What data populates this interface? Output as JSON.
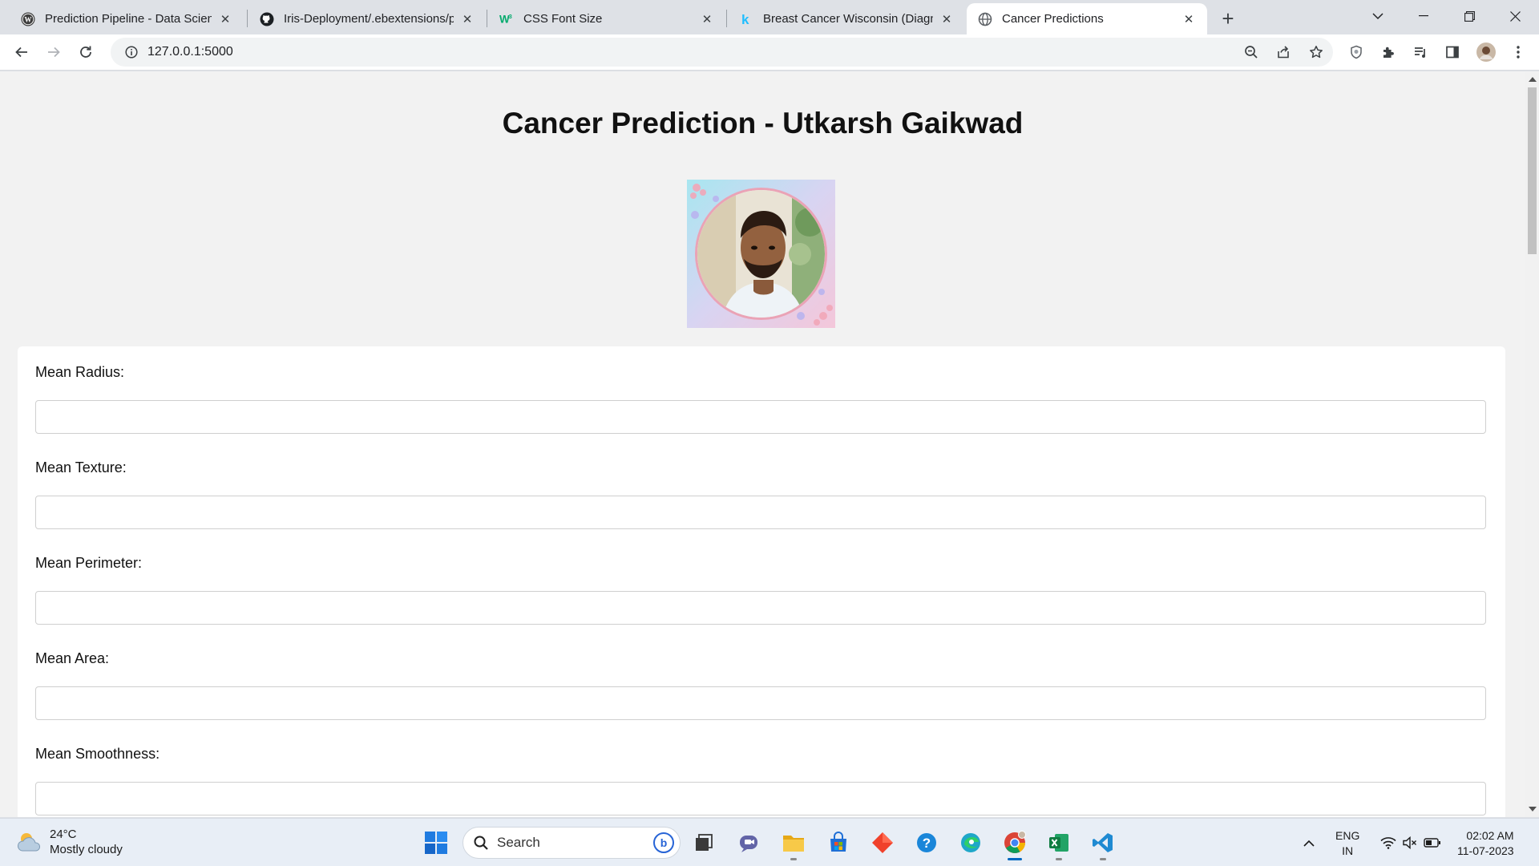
{
  "browser": {
    "tabs": [
      {
        "title": "Prediction Pipeline - Data Scienc",
        "icon": "wordpress-icon",
        "active": false
      },
      {
        "title": "Iris-Deployment/.ebextensions/p",
        "icon": "github-icon",
        "active": false
      },
      {
        "title": "CSS Font Size",
        "icon": "w3schools-icon",
        "active": false
      },
      {
        "title": "Breast Cancer Wisconsin (Diagno",
        "icon": "kaggle-icon",
        "active": false
      },
      {
        "title": "Cancer Predictions",
        "icon": "globe-icon",
        "active": true
      }
    ],
    "address": "127.0.0.1:5000"
  },
  "page": {
    "title": "Cancer Prediction - Utkarsh Gaikwad",
    "fields": [
      {
        "label": "Mean Radius:",
        "value": ""
      },
      {
        "label": "Mean Texture:",
        "value": ""
      },
      {
        "label": "Mean Perimeter:",
        "value": ""
      },
      {
        "label": "Mean Area:",
        "value": ""
      },
      {
        "label": "Mean Smoothness:",
        "value": ""
      }
    ]
  },
  "taskbar": {
    "weather": {
      "temp": "24°C",
      "desc": "Mostly cloudy"
    },
    "search_placeholder": "Search",
    "lang": {
      "line1": "ENG",
      "line2": "IN"
    },
    "clock": {
      "time": "02:02 AM",
      "date": "11-07-2023"
    }
  },
  "colors": {
    "page_bg": "#f2f2f2",
    "card_bg": "#ffffff",
    "accent": "#0067c0"
  }
}
